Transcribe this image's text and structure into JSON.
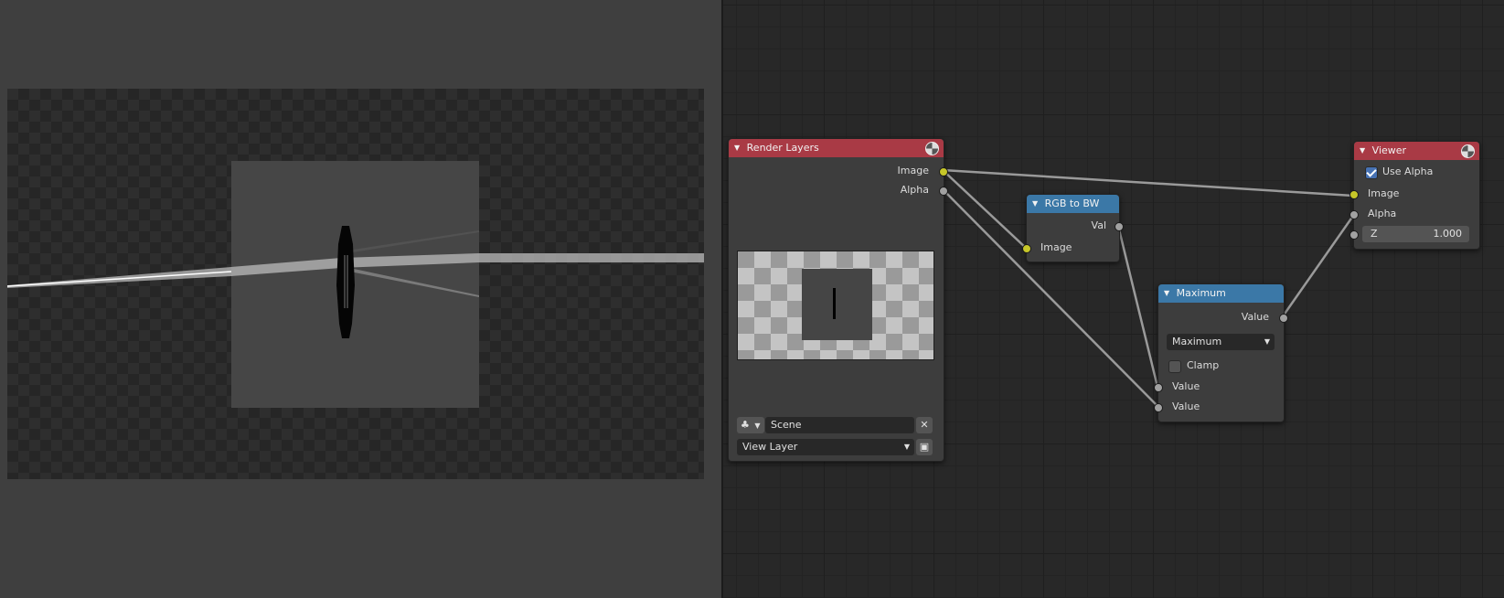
{
  "colors": {
    "render_header": "#a93a45",
    "converter_header": "#3b78a7",
    "image_socket": "#c7c729",
    "value_socket": "#a1a1a1",
    "checkbox_accent": "#4772b3"
  },
  "render_layers": {
    "title": "Render Layers",
    "outputs": [
      "Image",
      "Alpha"
    ],
    "scene_icon": "scene-icon",
    "scene_value": "Scene",
    "view_layer_value": "View Layer"
  },
  "rgb_to_bw": {
    "title": "RGB to BW",
    "output": "Val",
    "input": "Image"
  },
  "maximum": {
    "title": "Maximum",
    "output": "Value",
    "operation": "Maximum",
    "clamp_label": "Clamp",
    "clamp_checked": false,
    "inputs": [
      "Value",
      "Value"
    ]
  },
  "viewer": {
    "title": "Viewer",
    "use_alpha_label": "Use Alpha",
    "use_alpha_checked": true,
    "inputs": [
      "Image",
      "Alpha"
    ],
    "z_label": "Z",
    "z_value": "1.000"
  }
}
